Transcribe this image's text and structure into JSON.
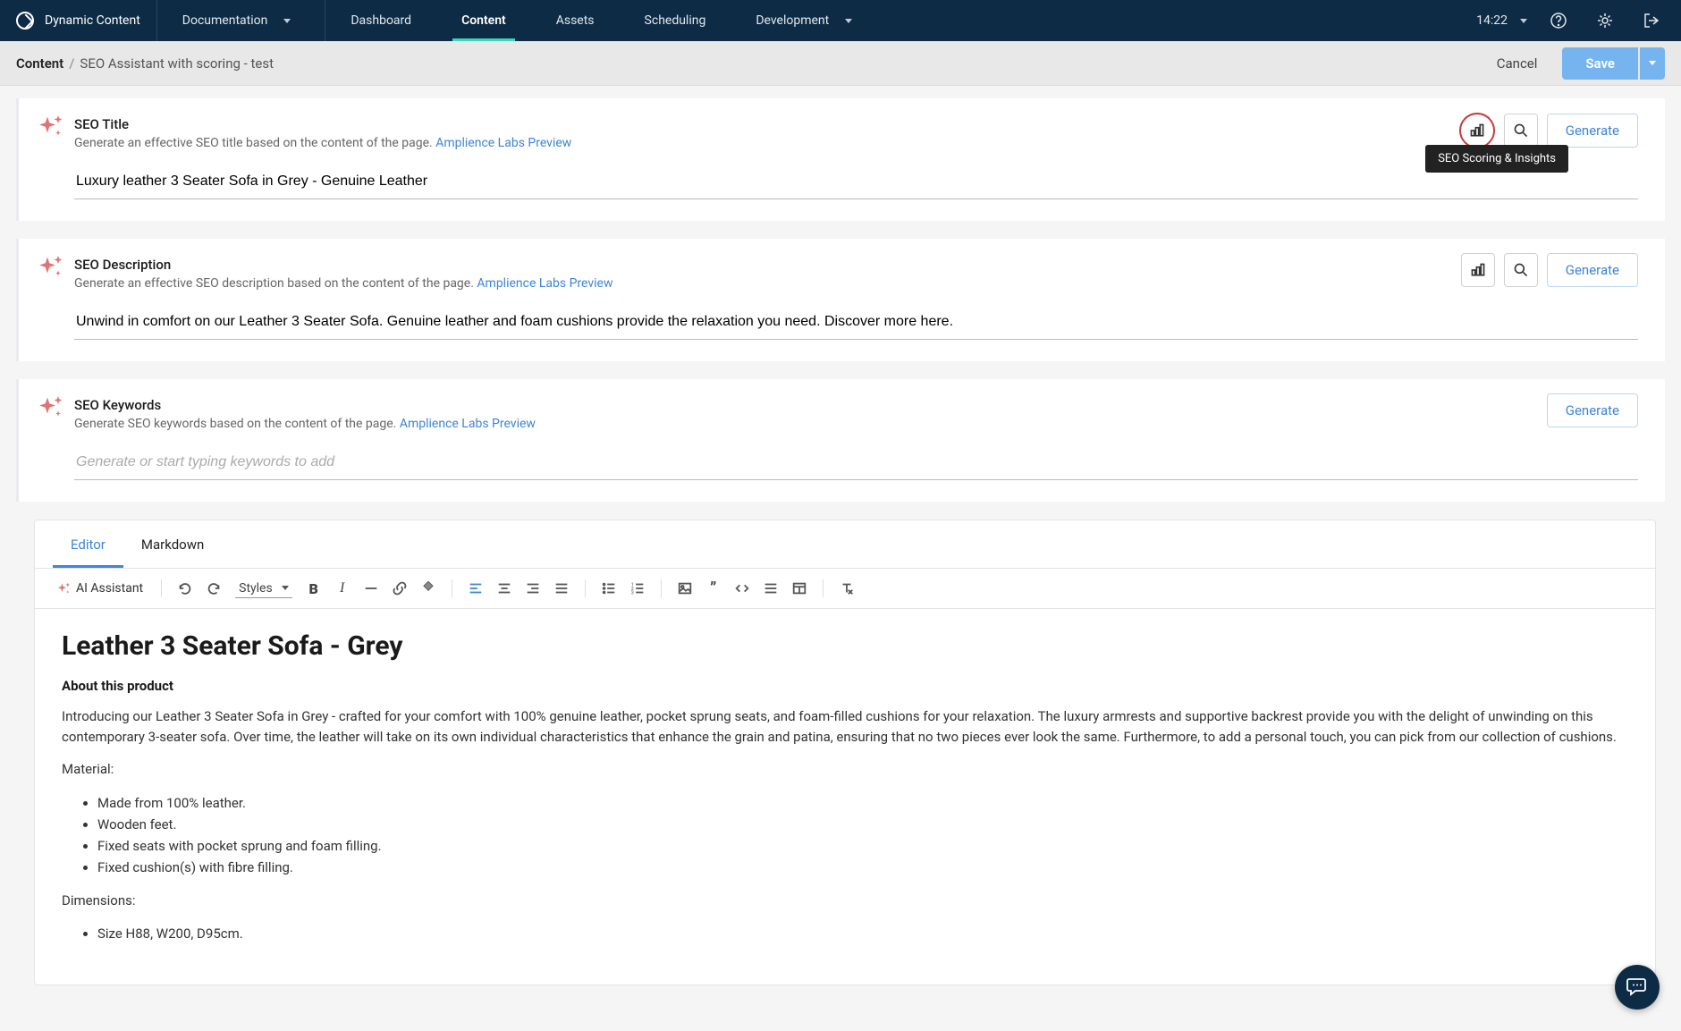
{
  "topnav": {
    "product": "Dynamic Content",
    "docs": "Documentation",
    "items": [
      "Dashboard",
      "Content",
      "Assets",
      "Scheduling",
      "Development"
    ],
    "active": "Content",
    "time": "14:22"
  },
  "subheader": {
    "root": "Content",
    "leaf": "SEO Assistant with scoring - test",
    "cancel": "Cancel",
    "save": "Save"
  },
  "fields": {
    "seo_title": {
      "title": "SEO Title",
      "desc": "Generate an effective SEO title based on the content of the page.",
      "link": "Amplience Labs Preview",
      "value": "Luxury leather 3 Seater Sofa in Grey - Genuine Leather",
      "generate": "Generate",
      "tooltip": "SEO Scoring & Insights"
    },
    "seo_desc": {
      "title": "SEO Description",
      "desc": "Generate an effective SEO description based on the content of the page.",
      "link": "Amplience Labs Preview",
      "value": "Unwind in comfort on our Leather 3 Seater Sofa. Genuine leather and foam cushions provide the relaxation you need. Discover more here.",
      "generate": "Generate"
    },
    "seo_keywords": {
      "title": "SEO Keywords",
      "desc": "Generate SEO keywords based on the content of the page.",
      "link": "Amplience Labs Preview",
      "placeholder": "Generate or start typing keywords to add",
      "generate": "Generate"
    }
  },
  "editor": {
    "tabs": {
      "editor": "Editor",
      "markdown": "Markdown"
    },
    "ai_label": "AI Assistant",
    "styles_label": "Styles",
    "body": {
      "h1": "Leather 3 Seater Sofa - Grey",
      "about_h": "About this product",
      "intro": "Introducing our Leather 3 Seater Sofa in Grey - crafted for your comfort with 100% genuine leather, pocket sprung seats, and foam-filled cushions for your relaxation. The luxury armrests and supportive backrest provide you with the delight of unwinding on this contemporary 3-seater sofa. Over time, the leather will take on its own individual characteristics that enhance the grain and patina, ensuring that no two pieces ever look the same. Furthermore, to add a personal touch, you can pick from our collection of cushions.",
      "material_h": "Material:",
      "material_items": [
        "Made from 100% leather.",
        "Wooden feet.",
        "Fixed seats with pocket sprung and foam filling.",
        "Fixed cushion(s) with fibre filling."
      ],
      "dimensions_h": "Dimensions:",
      "dimensions_items": [
        "Size H88, W200, D95cm."
      ]
    }
  }
}
